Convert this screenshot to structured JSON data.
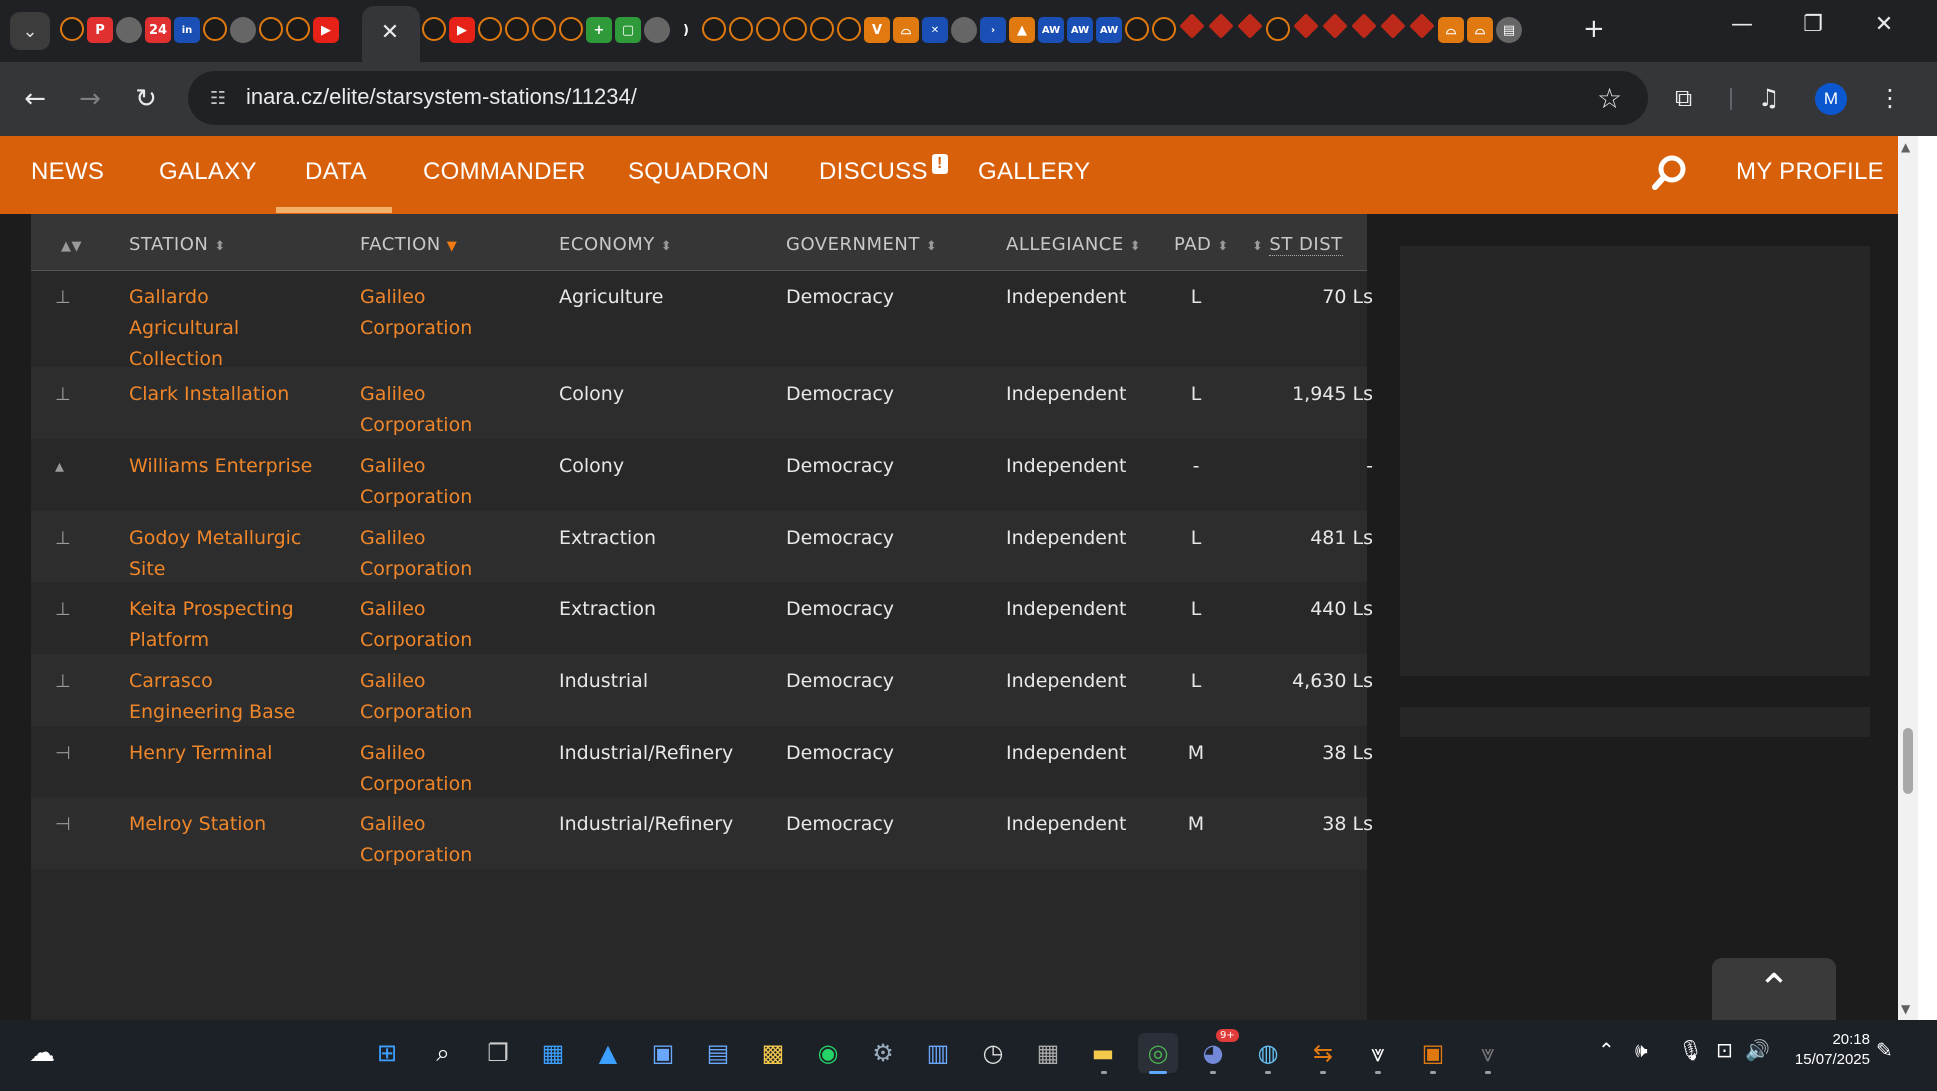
{
  "browser": {
    "url": "inara.cz/elite/starsystem-stations/11234/",
    "profile_initial": "M",
    "favicons": [
      "elite",
      "p",
      "globe",
      "tecom-24",
      "in",
      "elite",
      "line",
      "elite",
      "elite",
      "youtube"
    ],
    "favicons_right": [
      "elite",
      "youtube",
      "elite",
      "elite",
      "elite",
      "elite",
      "plus",
      "square",
      "circle",
      "rss",
      "elite",
      "elite",
      "elite",
      "elite",
      "elite",
      "elite",
      "wings",
      "dome",
      "wings2",
      "globe",
      "arrow",
      "flame",
      "aw",
      "aw",
      "aw",
      "elite",
      "elite",
      "diamond",
      "diamond",
      "diamond",
      "elite",
      "diamond",
      "diamond",
      "diamond",
      "diamond",
      "diamond",
      "dome",
      "dome",
      "box"
    ]
  },
  "nav": {
    "items": [
      "NEWS",
      "GALAXY",
      "DATA",
      "COMMANDER",
      "SQUADRON",
      "DISCUSS",
      "GALLERY"
    ],
    "notification": "!",
    "profile": "MY PROFILE"
  },
  "table": {
    "headers": {
      "station": "STATION",
      "faction": "FACTION",
      "economy": "ECONOMY",
      "government": "GOVERNMENT",
      "allegiance": "ALLEGIANCE",
      "pad": "PAD",
      "distance": "ST DIST"
    },
    "rows": [
      {
        "icon": "outpost-icon",
        "station": "Gallardo Agricultural Collection",
        "station_lines": [
          "Gallardo",
          "Agricultural",
          "Collection"
        ],
        "faction_lines": [
          "Galileo",
          "Corporation"
        ],
        "economy": "Agriculture",
        "government": "Democracy",
        "allegiance": "Independent",
        "pad": "L",
        "distance": "70 Ls"
      },
      {
        "icon": "outpost-icon",
        "station": "Clark Installation",
        "station_lines": [
          "Clark Installation"
        ],
        "faction_lines": [
          "Galileo",
          "Corporation"
        ],
        "economy": "Colony",
        "government": "Democracy",
        "allegiance": "Independent",
        "pad": "L",
        "distance": "1,945 Ls"
      },
      {
        "icon": "settlement-icon",
        "station": "Williams Enterprise",
        "station_lines": [
          "Williams Enterprise"
        ],
        "faction_lines": [
          "Galileo",
          "Corporation"
        ],
        "economy": "Colony",
        "government": "Democracy",
        "allegiance": "Independent",
        "pad": "-",
        "distance": "-"
      },
      {
        "icon": "outpost-icon",
        "station": "Godoy Metallurgic Site",
        "station_lines": [
          "Godoy Metallurgic",
          "Site"
        ],
        "faction_lines": [
          "Galileo",
          "Corporation"
        ],
        "economy": "Extraction",
        "government": "Democracy",
        "allegiance": "Independent",
        "pad": "L",
        "distance": "481 Ls"
      },
      {
        "icon": "outpost-icon",
        "station": "Keita Prospecting Platform",
        "station_lines": [
          "Keita Prospecting",
          "Platform"
        ],
        "faction_lines": [
          "Galileo",
          "Corporation"
        ],
        "economy": "Extraction",
        "government": "Democracy",
        "allegiance": "Independent",
        "pad": "L",
        "distance": "440 Ls"
      },
      {
        "icon": "outpost-icon",
        "station": "Carrasco Engineering Base",
        "station_lines": [
          "Carrasco",
          "Engineering Base"
        ],
        "faction_lines": [
          "Galileo",
          "Corporation"
        ],
        "economy": "Industrial",
        "government": "Democracy",
        "allegiance": "Independent",
        "pad": "L",
        "distance": "4,630 Ls"
      },
      {
        "icon": "port-icon",
        "station": "Henry Terminal",
        "station_lines": [
          "Henry Terminal"
        ],
        "faction_lines": [
          "Galileo",
          "Corporation"
        ],
        "economy": "Industrial/Refinery",
        "government": "Democracy",
        "allegiance": "Independent",
        "pad": "M",
        "distance": "38 Ls"
      },
      {
        "icon": "port-icon",
        "station": "Melroy Station",
        "station_lines": [
          "Melroy Station"
        ],
        "faction_lines": [
          "Galileo",
          "Corporation"
        ],
        "economy": "Industrial/Refinery",
        "government": "Democracy",
        "allegiance": "Independent",
        "pad": "M",
        "distance": "38 Ls"
      }
    ]
  },
  "taskbar": {
    "clock_time": "20:18",
    "clock_date": "15/07/2025",
    "notification_badge": "9+"
  },
  "colors": {
    "accent": "#d9600a",
    "link": "#f0862a",
    "background": "#1c1c1c"
  }
}
